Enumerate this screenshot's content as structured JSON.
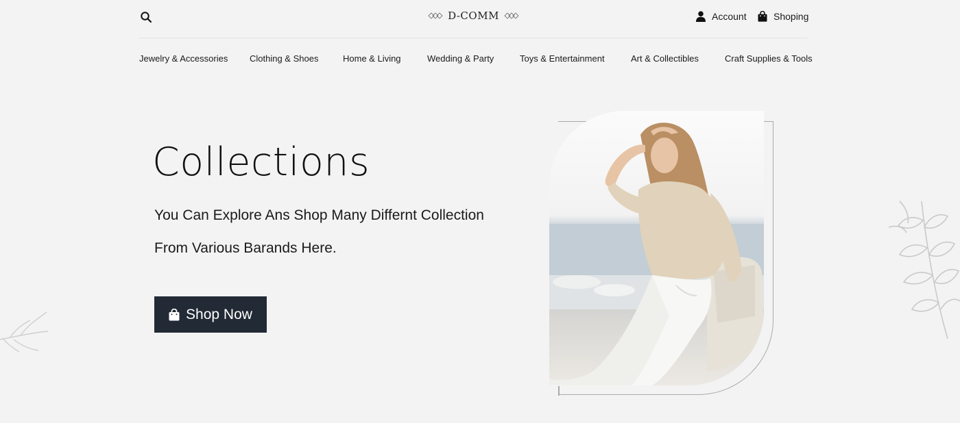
{
  "header": {
    "logo_text": "D-COMM",
    "account_label": "Account",
    "shop_label": "Shoping"
  },
  "nav": {
    "items": [
      "Jewelry & Accessories",
      "Clothing & Shoes",
      "Home & Living",
      "Wedding & Party",
      "Toys & Entertainment",
      "Art & Collectibles",
      "Craft Supplies & Tools"
    ]
  },
  "hero": {
    "title": "Collections",
    "subtitle_line1": "You Can Explore Ans Shop Many Differnt Collection",
    "subtitle_line2": "From Various Barands Here.",
    "cta_label": "Shop Now"
  },
  "icons": {
    "search": "search-icon",
    "account": "user-icon",
    "shop": "shopping-bag-icon",
    "cta": "shopping-bag-icon",
    "logo_ornament": "diamond-ornament-icon",
    "decor": "leaf-branch-icon"
  },
  "colors": {
    "background": "#f3f3f3",
    "button": "#222a35",
    "button_text": "#ffffff",
    "text": "#1a1a1a"
  }
}
